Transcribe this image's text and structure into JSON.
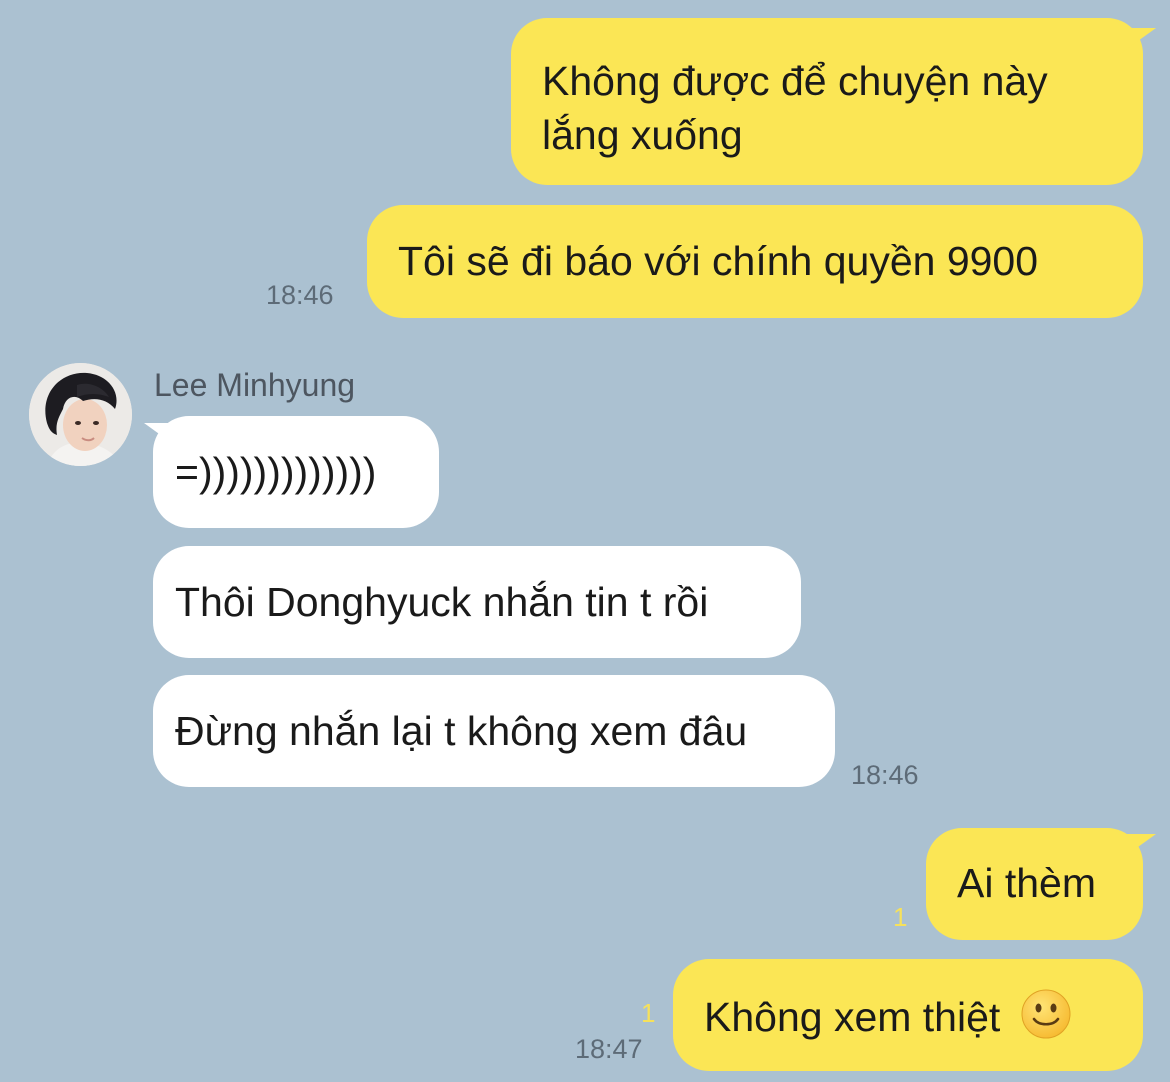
{
  "chat": {
    "messages": [
      {
        "id": "m1",
        "side": "me",
        "text_line1": "Không được để chuyện này",
        "text_line2": "lắng xuống"
      },
      {
        "id": "m2",
        "side": "me",
        "text": "Tôi sẽ đi báo với chính quyền 9900",
        "time": "18:46"
      },
      {
        "id": "m3",
        "side": "them",
        "text": "=)))))))))))))"
      },
      {
        "id": "m4",
        "side": "them",
        "text": "Thôi Donghyuck nhắn tin t rồi"
      },
      {
        "id": "m5",
        "side": "them",
        "text": "Đừng nhắn lại t không xem đâu",
        "time": "18:46"
      },
      {
        "id": "m6",
        "side": "me",
        "text": "Ai thèm",
        "unread": "1"
      },
      {
        "id": "m7",
        "side": "me",
        "text": "Không xem thiệt",
        "emoji": "slightly-smiling-face",
        "unread": "1",
        "time": "18:47"
      }
    ],
    "contact": {
      "name": "Lee Minhyung",
      "avatar": "profile-photo"
    },
    "colors": {
      "background": "#abc1d1",
      "my_bubble": "#fbe655",
      "their_bubble": "#ffffff",
      "unread_count": "#f6e15b"
    }
  }
}
